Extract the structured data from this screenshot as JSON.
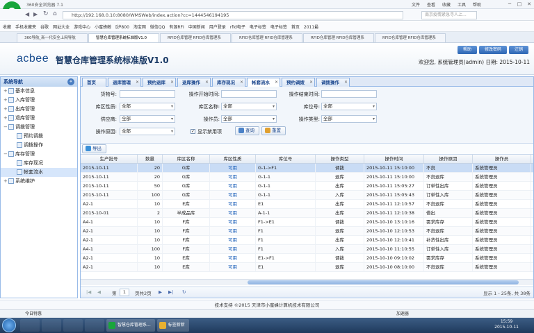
{
  "browser": {
    "title": "360安全浏览器 7.1",
    "menu": [
      "文件",
      "查看",
      "收藏",
      "工具",
      "帮助"
    ],
    "address": "http://192.168.0.10:8080/WMSWeb/index.action?cc=1444546194195",
    "search_placeholder": "南京疫情紧急寻人上...",
    "bookmarks": [
      "收藏",
      "手机收藏夹",
      "谷歌",
      "网址大全",
      "游戏中心",
      "小蜜蜂鲸",
      "[护800",
      "淘宝网",
      "微信QQ",
      "有源RFI",
      "中国新闻",
      "用户登录",
      "rfid电子",
      "电子标签",
      "电子标签",
      "首页",
      "2011最"
    ],
    "tabs": [
      "360导航_新一代安全上网导航",
      "智慧仓库管理系统标准版V1.0",
      "RFID仓库管理 RFID仓库管理系",
      "RFID仓库管理 RFID仓库管理系",
      "RFID仓库管理 RFID仓库管理系",
      "RFID仓库管理 RFID仓库管理系"
    ]
  },
  "app": {
    "brand": "acbee",
    "title": "智慧仓库管理系统标准版V1.0",
    "top_buttons": [
      "帮助",
      "修改密码",
      "注销"
    ],
    "welcome": "欢迎您,  系统管理员(admin) 日期:  2015-10-11"
  },
  "sidebar": {
    "header": "系统导航",
    "collapse_glyph": "«",
    "items": [
      {
        "label": "基本信息",
        "level": 0,
        "toggle": "+"
      },
      {
        "label": "入库管理",
        "level": 0,
        "toggle": "+"
      },
      {
        "label": "出库管理",
        "level": 0,
        "toggle": "+"
      },
      {
        "label": "退库管理",
        "level": 0,
        "toggle": "+"
      },
      {
        "label": "调拨管理",
        "level": 0,
        "toggle": "−"
      },
      {
        "label": "预约调拨",
        "level": 1,
        "toggle": ""
      },
      {
        "label": "调拨操作",
        "level": 1,
        "toggle": ""
      },
      {
        "label": "库存管理",
        "level": 0,
        "toggle": "−"
      },
      {
        "label": "库存现况",
        "level": 1,
        "toggle": ""
      },
      {
        "label": "帐套流水",
        "level": 1,
        "toggle": "",
        "selected": true
      },
      {
        "label": "系统维护",
        "level": 0,
        "toggle": "+"
      }
    ]
  },
  "app_tabs": [
    {
      "label": "首页",
      "closable": false
    },
    {
      "label": "退库管理",
      "closable": true
    },
    {
      "label": "预约退库",
      "closable": true
    },
    {
      "label": "退库操作",
      "closable": true
    },
    {
      "label": "库存现况",
      "closable": true
    },
    {
      "label": "帐套流水",
      "closable": true,
      "active": true
    },
    {
      "label": "预约调拨",
      "closable": true
    },
    {
      "label": "调拨操作",
      "closable": true
    }
  ],
  "filters": {
    "material_no": {
      "label": "货物号:",
      "value": ""
    },
    "op_start": {
      "label": "操作开始时间:",
      "value": ""
    },
    "op_end": {
      "label": "操作结束时间:",
      "value": ""
    },
    "area_type": {
      "label": "库区性质:",
      "value": "全部"
    },
    "area_name": {
      "label": "库区名称:",
      "value": "全部"
    },
    "location": {
      "label": "库位号:",
      "value": "全部"
    },
    "supplier": {
      "label": "供应商:",
      "value": "全部"
    },
    "operator": {
      "label": "操作员:",
      "value": "全部"
    },
    "op_type": {
      "label": "操作类型:",
      "value": "全部"
    },
    "reason": {
      "label": "操作原因:",
      "value": "全部"
    },
    "show_disabled": "显示禁用项",
    "query_btn": "查询",
    "reset_btn": "重置"
  },
  "toolbar": {
    "export": "导出"
  },
  "grid": {
    "columns": [
      "生产批号",
      "数量",
      "库区名称",
      "库区性质",
      "库位号",
      "操作类型",
      "操作时间",
      "操作原因",
      "操作员"
    ],
    "rows": [
      [
        "2015-10-11",
        "20",
        "G库",
        "可用",
        "G-1->F1",
        "调拨",
        "2015-10-11 15:10:00",
        "不良",
        "系统管理员"
      ],
      [
        "2015-10-11",
        "20",
        "G库",
        "可用",
        "G-1-1",
        "退库",
        "2015-10-11 15:10:00",
        "不良退库",
        "系统管理员"
      ],
      [
        "2015-10-11",
        "50",
        "G库",
        "可用",
        "G-1-1",
        "出库",
        "2015-10-11 15:05:27",
        "订单性出库",
        "系统管理员"
      ],
      [
        "2015-10-11",
        "100",
        "G库",
        "可用",
        "G-1-1",
        "入库",
        "2015-10-11 15:05:43",
        "订单性入库",
        "系统管理员"
      ],
      [
        "A2-1",
        "10",
        "E库",
        "可用",
        "E1",
        "出库",
        "2015-10-11 12:10:57",
        "不良退库",
        "系统管理员"
      ],
      [
        "2015-10-01",
        "2",
        "半成品库",
        "可用",
        "A-1-1",
        "出库",
        "2015-10-11 12:10:38",
        "借出",
        "系统管理员"
      ],
      [
        "A4-1",
        "10",
        "F库",
        "可用",
        "F1->E1",
        "调拨",
        "2015-10-10 13:10:16",
        "需求库存",
        "系统管理员"
      ],
      [
        "A2-1",
        "10",
        "F库",
        "可用",
        "F1",
        "退库",
        "2015-10-10 12:10:53",
        "不良退库",
        "系统管理员"
      ],
      [
        "A2-1",
        "10",
        "F库",
        "可用",
        "F1",
        "出库",
        "2015-10-10 12:10:41",
        "补货性出库",
        "系统管理员"
      ],
      [
        "A4-1",
        "100",
        "F库",
        "可用",
        "F1",
        "入库",
        "2015-10-10 11:10:55",
        "订单性入库",
        "系统管理员"
      ],
      [
        "A2-1",
        "10",
        "E库",
        "可用",
        "E1->F1",
        "调拨",
        "2015-10-10 09:10:02",
        "需求库存",
        "系统管理员"
      ],
      [
        "A2-1",
        "10",
        "E库",
        "可用",
        "E1",
        "退库",
        "2015-10-10 08:10:00",
        "不良退库",
        "系统管理员"
      ]
    ]
  },
  "pager": {
    "page_label": "第",
    "page_value": "1",
    "total_pages": "页共2页",
    "summary": "显示 1 - 25条, 共 38条"
  },
  "footer": "技术支持 ©2015 天津市小蜜蜂计算机技术有限公司",
  "statusbar": {
    "left": "今日特惠",
    "right": "加速器"
  },
  "taskbar": {
    "windows": [
      "智慧仓库管理系...",
      "标签新新"
    ],
    "time": "15:59",
    "date": "2015-10-11"
  },
  "colors": {
    "accent": "#2e66b4",
    "link": "#1b5fb9",
    "brand": "#1a4d8f"
  }
}
